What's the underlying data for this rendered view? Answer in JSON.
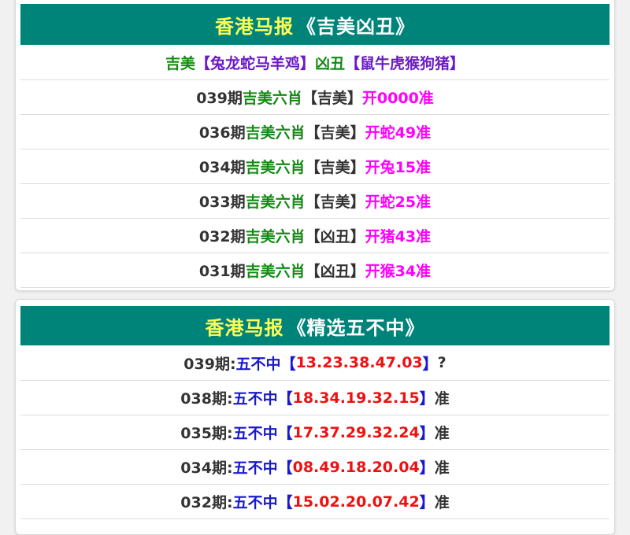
{
  "card1": {
    "header": {
      "title": "香港马报",
      "subtitle": "《吉美凶丑》"
    },
    "legend": {
      "good_label": "吉美",
      "good_animals": "【兔龙蛇马羊鸡】",
      "bad_label": "凶丑",
      "bad_animals": "【鼠牛虎猴狗猪】"
    },
    "rows": [
      {
        "period": "039期",
        "label": "吉美六肖",
        "pick": "【吉美】",
        "result": "开0000准"
      },
      {
        "period": "036期",
        "label": "吉美六肖",
        "pick": "【吉美】",
        "result": "开蛇49准"
      },
      {
        "period": "034期",
        "label": "吉美六肖",
        "pick": "【吉美】",
        "result": "开兔15准"
      },
      {
        "period": "033期",
        "label": "吉美六肖",
        "pick": "【吉美】",
        "result": "开蛇25准"
      },
      {
        "period": "032期",
        "label": "吉美六肖",
        "pick": "【凶丑】",
        "result": "开猪43准"
      },
      {
        "period": "031期",
        "label": "吉美六肖",
        "pick": "【凶丑】",
        "result": "开猴34准"
      }
    ]
  },
  "card2": {
    "header": {
      "title": "香港马报",
      "subtitle": "《精选五不中》"
    },
    "rows": [
      {
        "period": "039期:",
        "label": "五不中",
        "open": "【",
        "numbers": "13.23.38.47.03",
        "close": "】",
        "status": "?"
      },
      {
        "period": "038期:",
        "label": "五不中",
        "open": "【",
        "numbers": "18.34.19.32.15",
        "close": "】",
        "status": "准"
      },
      {
        "period": "035期:",
        "label": "五不中",
        "open": "【",
        "numbers": "17.37.29.32.24",
        "close": "】",
        "status": "准"
      },
      {
        "period": "034期:",
        "label": "五不中",
        "open": "【",
        "numbers": "08.49.18.20.04",
        "close": "】",
        "status": "准"
      },
      {
        "period": "032期:",
        "label": "五不中",
        "open": "【",
        "numbers": "15.02.20.07.42",
        "close": "】",
        "status": "准"
      }
    ]
  },
  "colors": {
    "header_bg": "#00847a",
    "header_title": "#ffff55",
    "green": "#138a13",
    "purple": "#6a1bc4",
    "magenta": "#ff00ff",
    "blue": "#1a1acc",
    "red": "#ee1111"
  }
}
